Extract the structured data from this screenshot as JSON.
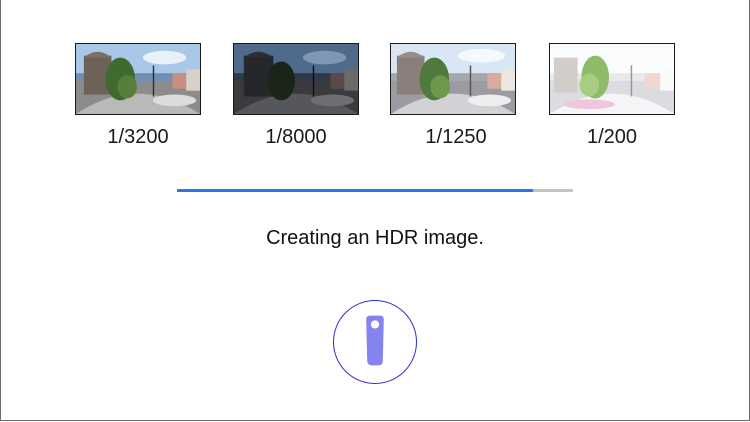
{
  "exposures": [
    {
      "label": "1/3200"
    },
    {
      "label": "1/8000"
    },
    {
      "label": "1/1250"
    },
    {
      "label": "1/200"
    }
  ],
  "progress": {
    "fraction": 0.9
  },
  "status": {
    "text": "Creating an HDR image."
  },
  "camera_button": {
    "icon": "360-camera-icon",
    "ring_color": "#2e2ecf",
    "body_color": "#8583f0"
  },
  "colors": {
    "progress_fill": "#2a78e4",
    "progress_track": "#c4c4c4"
  }
}
